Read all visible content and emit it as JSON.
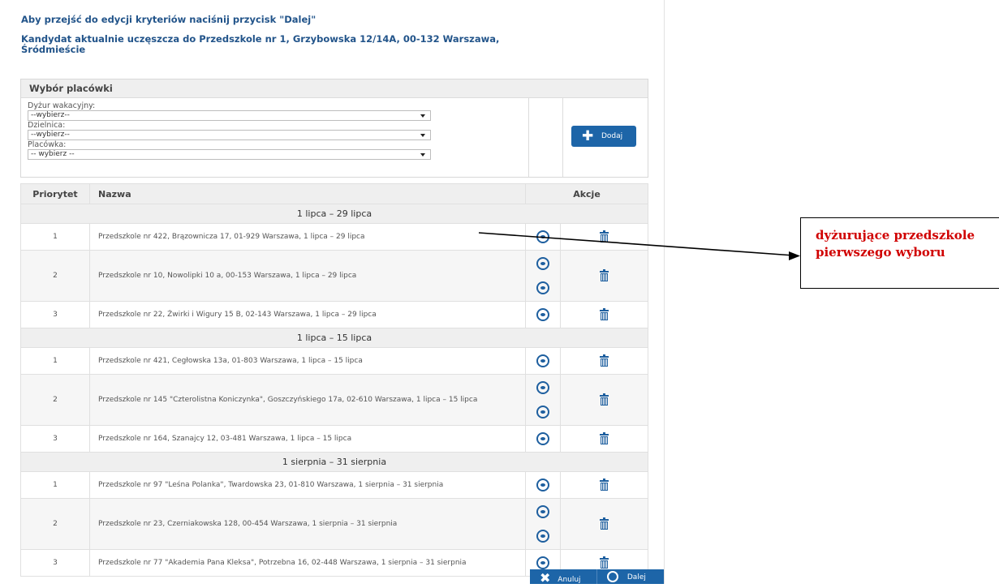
{
  "instructions": {
    "line1": "Aby przejść do edycji kryteriów naciśnij przycisk \"Dalej\"",
    "line2": "Kandydat aktualnie uczęszcza do Przedszkole nr 1, Grzybowska 12/14A, 00-132 Warszawa,",
    "line3": "Śródmieście"
  },
  "selection": {
    "header": "Wybór placówki",
    "fields": [
      {
        "label": "Dyżur wakacyjny:",
        "value": "--wybierz--"
      },
      {
        "label": "Dzielnica:",
        "value": "--wybierz--"
      },
      {
        "label": "Placówka:",
        "value": "-- wybierz --"
      }
    ],
    "add_label": "Dodaj"
  },
  "table": {
    "columns": [
      "Priorytet",
      "Nazwa",
      "Akcje"
    ],
    "groups": [
      {
        "title": "1 lipca – 29 lipca",
        "rows": [
          {
            "priority": "1",
            "name": "Przedszkole nr 422, Brązownicza 17, 01-929 Warszawa, 1 lipca – 29 lipca"
          },
          {
            "priority": "2",
            "name": "Przedszkole nr 10, Nowolipki 10 a, 00-153 Warszawa, 1 lipca – 29 lipca"
          },
          {
            "priority": "3",
            "name": "Przedszkole nr 22, Żwirki i Wigury 15 B, 02-143 Warszawa, 1 lipca – 29 lipca"
          }
        ]
      },
      {
        "title": "1 lipca – 15 lipca",
        "rows": [
          {
            "priority": "1",
            "name": "Przedszkole nr 421, Cegłowska 13a, 01-803 Warszawa, 1 lipca – 15 lipca"
          },
          {
            "priority": "2",
            "name": "Przedszkole nr 145 \"Czterolistna Koniczynka\", Goszczyńskiego 17a, 02-610 Warszawa, 1 lipca – 15 lipca"
          },
          {
            "priority": "3",
            "name": "Przedszkole nr 164, Szanajcy 12, 03-481 Warszawa, 1 lipca – 15 lipca"
          }
        ]
      },
      {
        "title": "1 sierpnia – 31 sierpnia",
        "rows": [
          {
            "priority": "1",
            "name": "Przedszkole nr 97 \"Leśna Polanka\", Twardowska 23, 01-810 Warszawa, 1 sierpnia – 31 sierpnia"
          },
          {
            "priority": "2",
            "name": "Przedszkole nr 23, Czerniakowska 128, 00-454 Warszawa, 1 sierpnia – 31 sierpnia"
          },
          {
            "priority": "3",
            "name": "Przedszkole nr 77 \"Akademia Pana Kleksa\", Potrzebna 16, 02-448 Warszawa, 1 sierpnia – 31 sierpnia"
          }
        ]
      }
    ]
  },
  "actions": {
    "cancel_label": "Anuluj",
    "next_label": "Dalej"
  },
  "callout": {
    "line1": "dyżurujące przedszkole",
    "line2": "pierwszego wyboru"
  },
  "colors": {
    "accent": "#1d65a8",
    "title": "#22548a",
    "callout_text": "#d00000"
  },
  "icons": [
    "plus-icon",
    "eye-icon",
    "trash-icon",
    "close-x-icon"
  ]
}
